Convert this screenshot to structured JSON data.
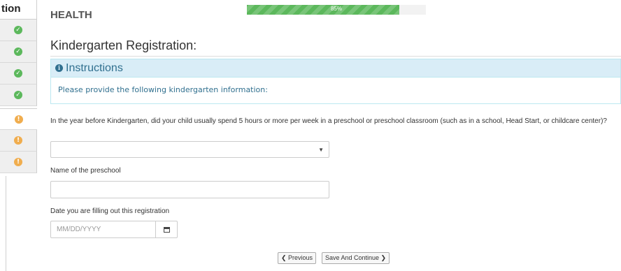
{
  "sidebar": {
    "title": "tion",
    "steps": [
      {
        "status": "complete",
        "icon": "check-circle-icon"
      },
      {
        "status": "complete",
        "icon": "check-circle-icon"
      },
      {
        "status": "complete",
        "icon": "check-circle-icon"
      },
      {
        "status": "complete",
        "icon": "check-circle-icon"
      },
      {
        "status": "current-incomplete",
        "icon": "exclamation-circle-icon"
      },
      {
        "status": "incomplete",
        "icon": "exclamation-circle-icon"
      },
      {
        "status": "incomplete",
        "icon": "exclamation-circle-icon"
      }
    ]
  },
  "header": {
    "section": "HEALTH",
    "progress_text": "85%",
    "progress_value": 0.85
  },
  "page": {
    "title": "Kindergarten Registration:"
  },
  "instructions": {
    "title": "Instructions",
    "body": "Please provide the following kindergarten information:"
  },
  "form": {
    "preschool_question": "In the year before Kindergarten, did your child usually spend 5 hours or more per week in a preschool or preschool classroom (such as in a school, Head Start, or childcare center)?",
    "preschool_select_value": "",
    "preschool_name_label": "Name of the preschool",
    "preschool_name_value": "",
    "date_label": "Date you are filling out this registration",
    "date_placeholder": "MM/DD/YYYY"
  },
  "buttons": {
    "previous": "❮ Previous",
    "save_continue": "Save And Continue ❯"
  },
  "colors": {
    "success": "#5cb85c",
    "warning": "#f0ad4e",
    "info_text": "#31708f",
    "info_bg": "#d9edf7"
  }
}
